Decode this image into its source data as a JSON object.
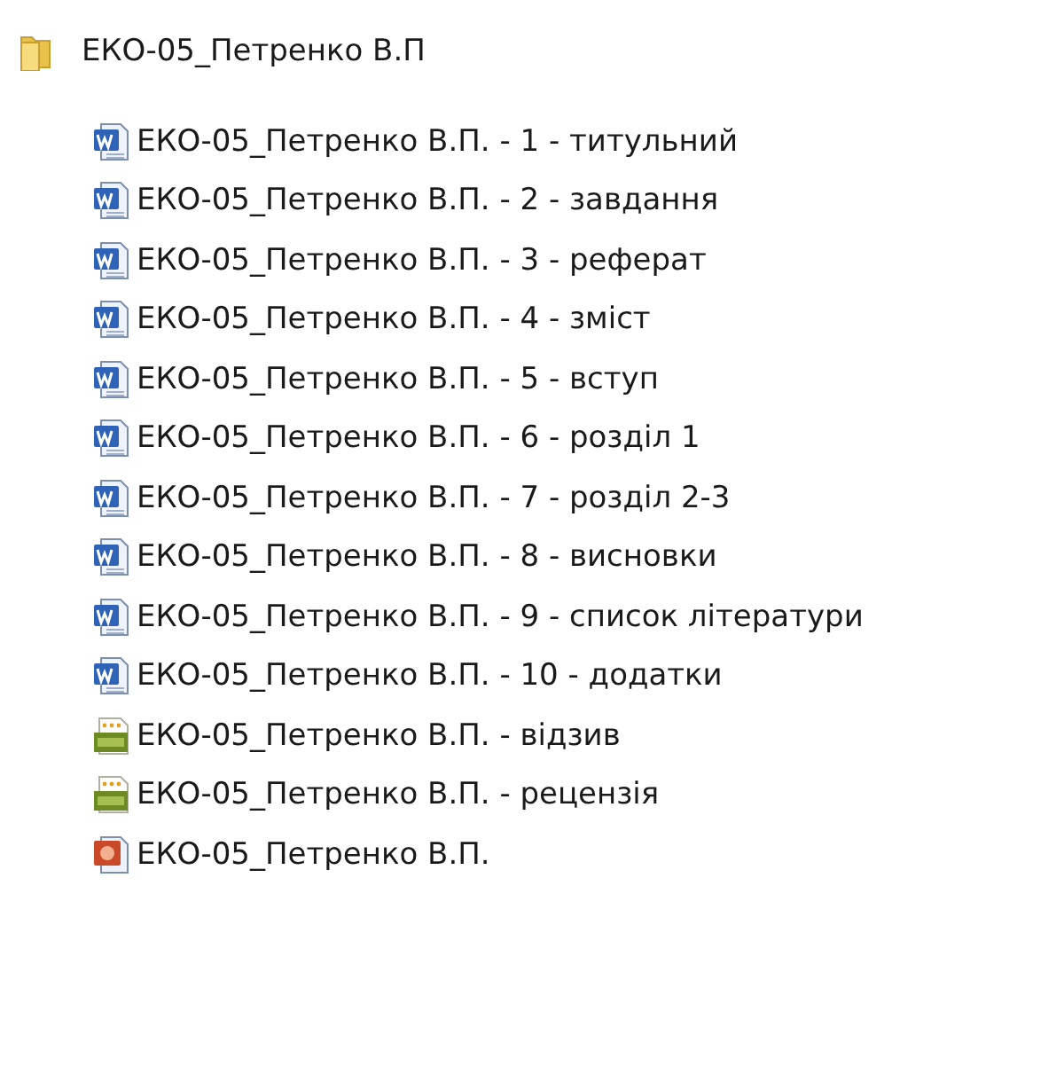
{
  "folder": {
    "name": "ЕКО-05_Петренко В.П"
  },
  "files": [
    {
      "name": "ЕКО-05_Петренко В.П. - 1 - титульний",
      "kind": "word"
    },
    {
      "name": "ЕКО-05_Петренко В.П. - 2 - завдання",
      "kind": "word"
    },
    {
      "name": "ЕКО-05_Петренко В.П. - 3 - реферат",
      "kind": "word"
    },
    {
      "name": "ЕКО-05_Петренко В.П. - 4 - зміст",
      "kind": "word"
    },
    {
      "name": "ЕКО-05_Петренко В.П. - 5 - вступ",
      "kind": "word"
    },
    {
      "name": "ЕКО-05_Петренко В.П. - 6 - розділ 1",
      "kind": "word"
    },
    {
      "name": "ЕКО-05_Петренко В.П. - 7 - розділ 2-3",
      "kind": "word"
    },
    {
      "name": "ЕКО-05_Петренко В.П. - 8 - висновки",
      "kind": "word"
    },
    {
      "name": "ЕКО-05_Петренко В.П. - 9 - список літератури",
      "kind": "word"
    },
    {
      "name": "ЕКО-05_Петренко В.П. - 10 - додатки",
      "kind": "word"
    },
    {
      "name": "ЕКО-05_Петренко В.П. - відзив",
      "kind": "image"
    },
    {
      "name": "ЕКО-05_Петренко В.П. - рецензія",
      "kind": "image"
    },
    {
      "name": "ЕКО-05_Петренко В.П.",
      "kind": "slides"
    }
  ]
}
